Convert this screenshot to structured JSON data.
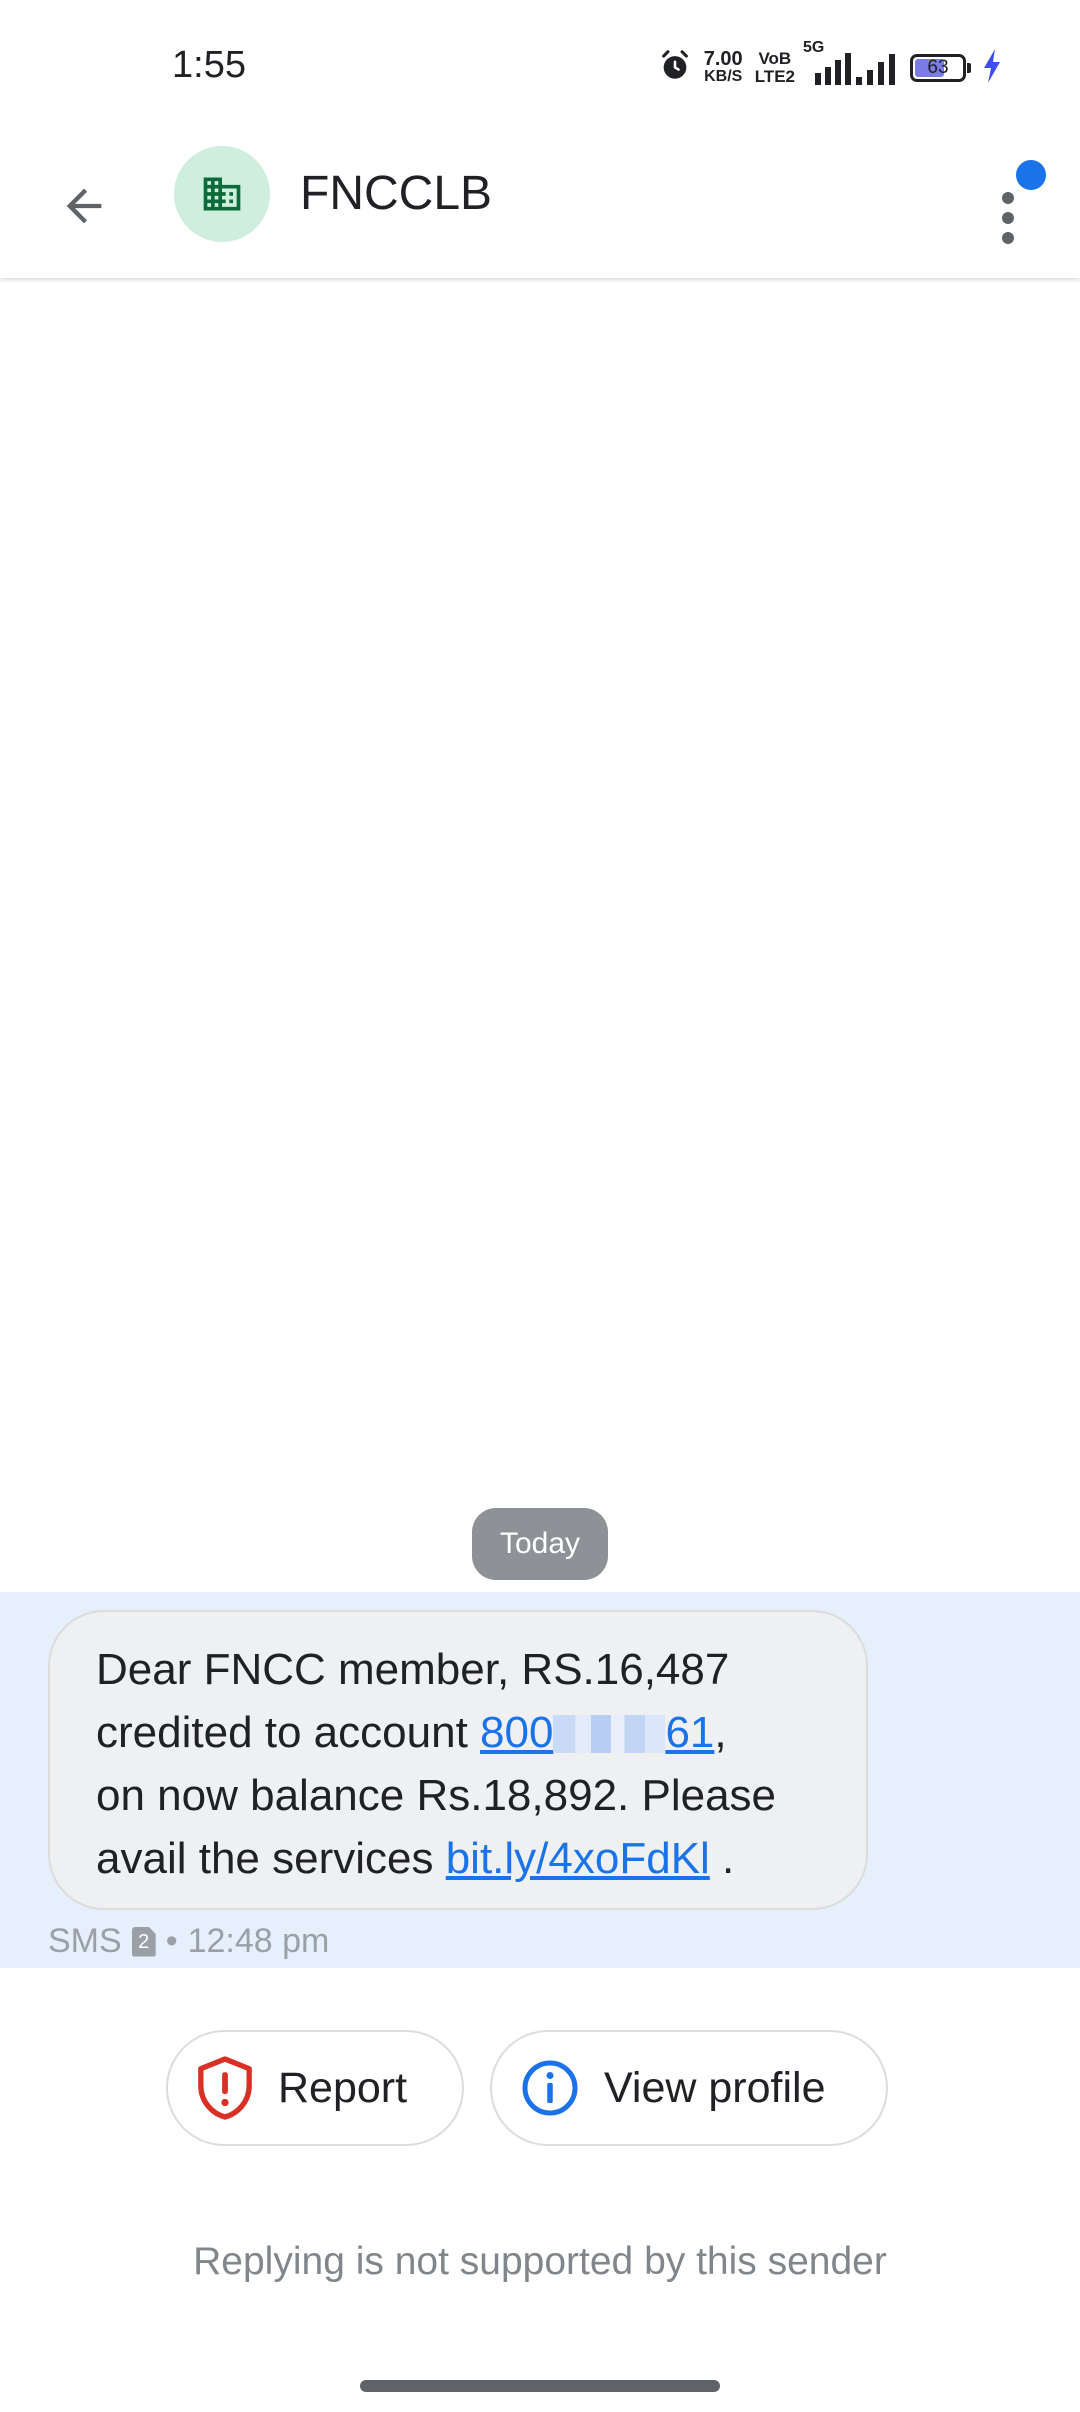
{
  "status_bar": {
    "time": "1:55",
    "net_speed_value": "7.00",
    "net_speed_unit": "KB/S",
    "volte_top": "VoB",
    "volte_bottom": "LTE2",
    "network_type": "5G",
    "battery_level": "63",
    "battery_fraction": 0.63,
    "icons": [
      "alarm-icon",
      "signal-icon",
      "charging-icon"
    ]
  },
  "app_bar": {
    "sender_name": "FNCCLB",
    "avatar_icon": "business-icon",
    "avatar_color": "#cfeedd",
    "icon_color": "#0b6b3a"
  },
  "conversation": {
    "date_label": "Today",
    "message": {
      "line1": "Dear FNCC member, RS.16,487",
      "line2_prefix": "credited to account ",
      "account_start": "800",
      "account_end": "61",
      "line2_suffix": ",",
      "line3": "on now balance Rs.18,892. Please",
      "line4_prefix": "avail the services ",
      "link": "bit.ly/4xoFdKl",
      "line4_suffix": " ."
    },
    "meta": {
      "channel": "SMS",
      "sim": "2",
      "separator": "•",
      "time": "12:48 pm"
    }
  },
  "actions": {
    "report_label": "Report",
    "view_profile_label": "View profile"
  },
  "footer": {
    "reply_note": "Replying is not supported by this sender"
  },
  "colors": {
    "accent": "#1a73e8",
    "report_red": "#d93025",
    "message_row_bg": "#e6effc"
  }
}
